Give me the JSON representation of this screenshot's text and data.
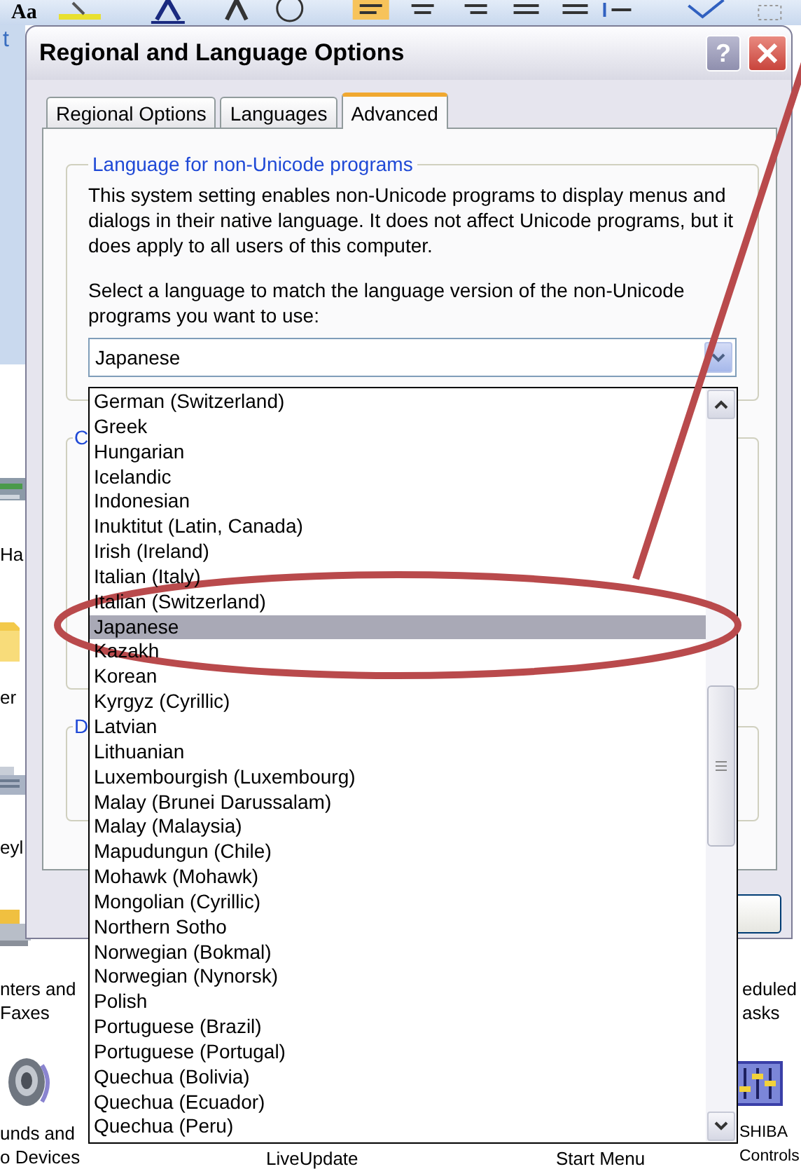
{
  "background_window": {
    "toolbar": {
      "style_label": "Aa"
    },
    "side_text": "t",
    "desktop_items": [
      {
        "lines": [
          "Ha"
        ],
        "kind": "drive"
      },
      {
        "lines": [
          "er"
        ],
        "kind": "folder"
      },
      {
        "lines": [
          "eyl"
        ],
        "kind": "keyboard"
      },
      {
        "lines": [
          "nters and",
          "Faxes"
        ],
        "kind": "printer"
      },
      {
        "lines": [
          "unds and",
          "o Devices"
        ],
        "kind": "speaker"
      },
      {
        "lines": [
          "LiveUpdate"
        ],
        "kind": "label"
      },
      {
        "lines": [
          "Start Menu"
        ],
        "kind": "label"
      },
      {
        "lines": [
          "eduled",
          "asks"
        ],
        "kind": "label"
      },
      {
        "lines": [
          "SHIBA",
          "Controls"
        ],
        "kind": "mixer"
      }
    ]
  },
  "dialog": {
    "title": "Regional and Language Options",
    "help_button": "?",
    "tabs": [
      {
        "label": "Regional Options",
        "selected": false
      },
      {
        "label": "Languages",
        "selected": false
      },
      {
        "label": "Advanced",
        "selected": true
      }
    ],
    "group": {
      "title": "Language for non-Unicode programs",
      "description": "This system setting enables non-Unicode programs to display menus and dialogs in their native language. It does not affect Unicode programs, but it does apply to all users of this computer.",
      "prompt": "Select a language to match the language version of the non-Unicode programs you want to use:",
      "combo": {
        "value": "Japanese",
        "expanded": true
      }
    },
    "other_groups": [
      {
        "title": "C"
      },
      {
        "title": "D"
      }
    ],
    "dropdown_items": [
      {
        "label": "German (Switzerland)",
        "selected": false
      },
      {
        "label": "Greek",
        "selected": false
      },
      {
        "label": "Hungarian",
        "selected": false
      },
      {
        "label": "Icelandic",
        "selected": false
      },
      {
        "label": "Indonesian",
        "selected": false
      },
      {
        "label": "Inuktitut (Latin, Canada)",
        "selected": false
      },
      {
        "label": "Irish (Ireland)",
        "selected": false
      },
      {
        "label": "Italian (Italy)",
        "selected": false
      },
      {
        "label": "Italian (Switzerland)",
        "selected": false
      },
      {
        "label": "Japanese",
        "selected": true
      },
      {
        "label": "Kazakh",
        "selected": false
      },
      {
        "label": "Korean",
        "selected": false
      },
      {
        "label": "Kyrgyz (Cyrillic)",
        "selected": false
      },
      {
        "label": "Latvian",
        "selected": false
      },
      {
        "label": "Lithuanian",
        "selected": false
      },
      {
        "label": "Luxembourgish (Luxembourg)",
        "selected": false
      },
      {
        "label": "Malay (Brunei Darussalam)",
        "selected": false
      },
      {
        "label": "Malay (Malaysia)",
        "selected": false
      },
      {
        "label": "Mapudungun (Chile)",
        "selected": false
      },
      {
        "label": "Mohawk (Mohawk)",
        "selected": false
      },
      {
        "label": "Mongolian (Cyrillic)",
        "selected": false
      },
      {
        "label": "Northern Sotho",
        "selected": false
      },
      {
        "label": "Norwegian (Bokmal)",
        "selected": false
      },
      {
        "label": "Norwegian (Nynorsk)",
        "selected": false
      },
      {
        "label": "Polish",
        "selected": false
      },
      {
        "label": "Portuguese (Brazil)",
        "selected": false
      },
      {
        "label": "Portuguese (Portugal)",
        "selected": false
      },
      {
        "label": "Quechua (Bolivia)",
        "selected": false
      },
      {
        "label": "Quechua (Ecuador)",
        "selected": false
      },
      {
        "label": "Quechua (Peru)",
        "selected": false
      }
    ]
  }
}
